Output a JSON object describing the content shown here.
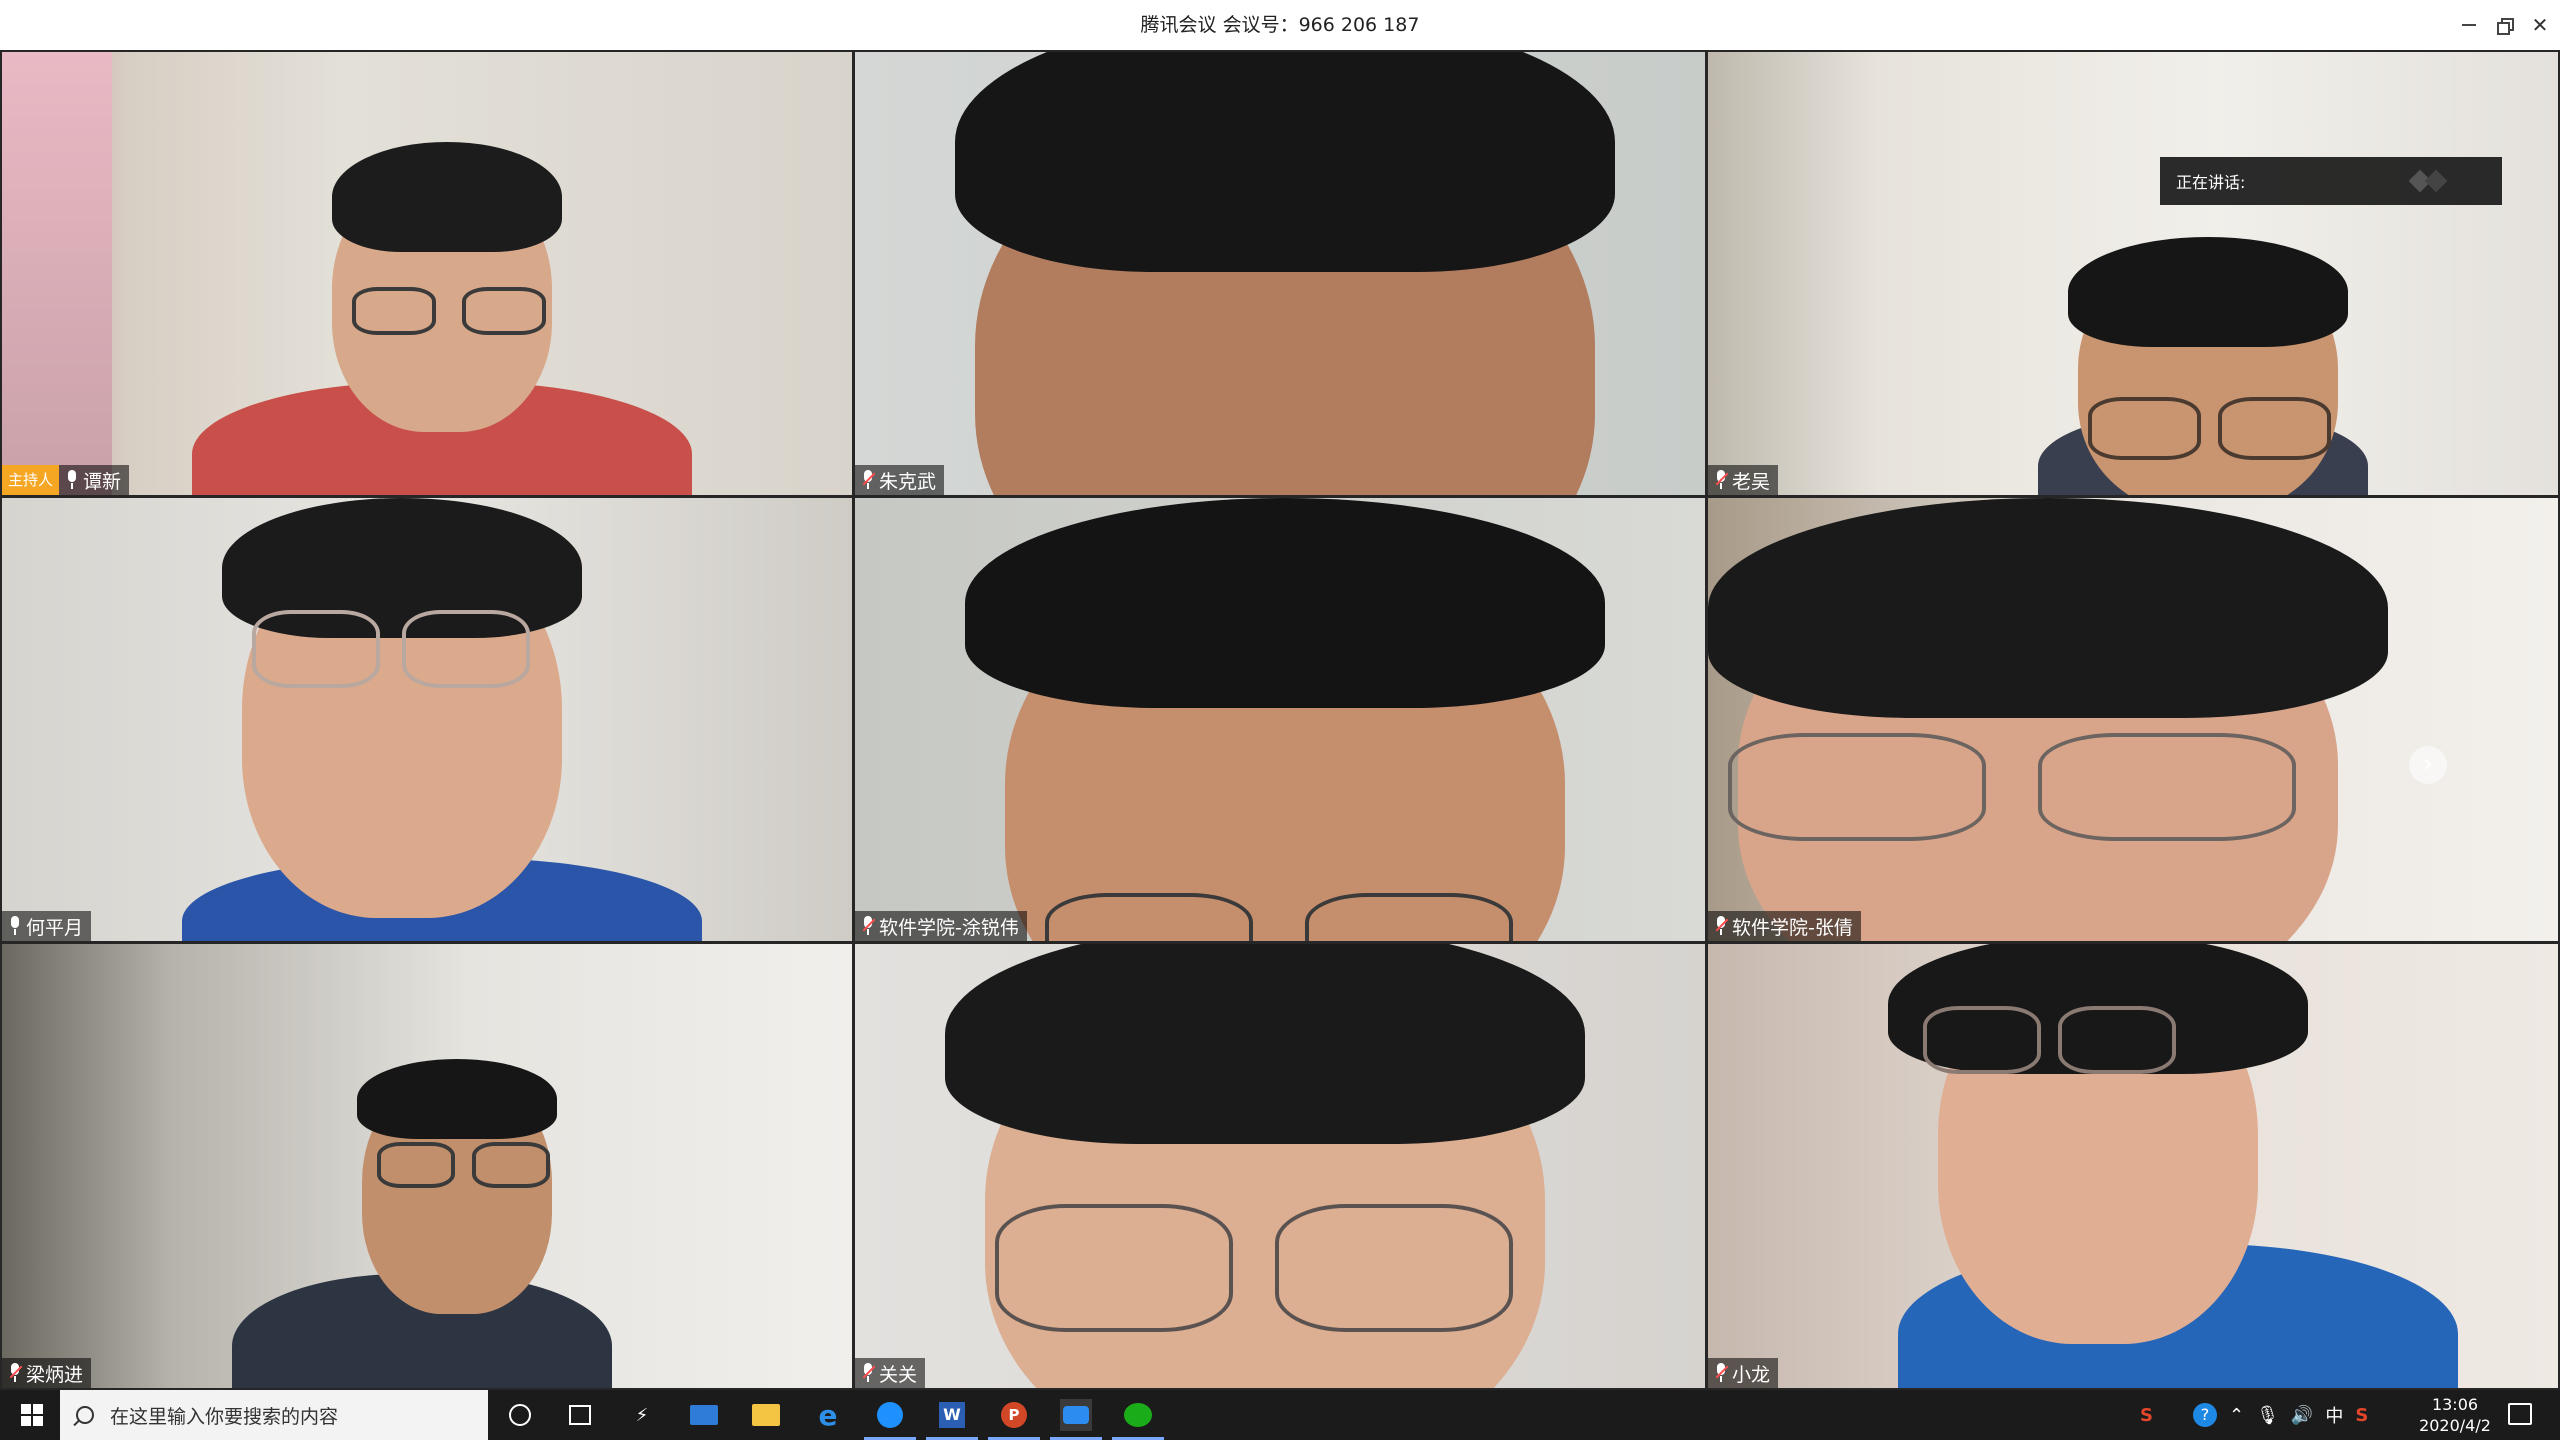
{
  "window": {
    "title": "腾讯会议 会议号：966 206 187"
  },
  "participants": [
    {
      "name": "谭新",
      "host_badge": "主持人",
      "mic": "on"
    },
    {
      "name": "朱克武",
      "mic": "muted"
    },
    {
      "name": "老吴",
      "mic": "muted"
    },
    {
      "name": "何平月",
      "mic": "on"
    },
    {
      "name": "软件学院-涂锐伟",
      "mic": "muted"
    },
    {
      "name": "软件学院-张倩",
      "mic": "muted"
    },
    {
      "name": "梁炳进",
      "mic": "muted"
    },
    {
      "name": "关关",
      "mic": "muted"
    },
    {
      "name": "小龙",
      "mic": "muted"
    }
  ],
  "speaking_indicator": {
    "label": "正在讲话:"
  },
  "taskbar": {
    "search_placeholder": "在这里输入你要搜索的内容",
    "ime_label": "中",
    "time": "13:06",
    "date": "2020/4/2"
  },
  "icons": [
    "windows-start-icon",
    "search-icon",
    "cortana-icon",
    "task-view-icon",
    "mail-icon",
    "file-explorer-icon",
    "edge-icon",
    "qq-browser-icon",
    "word-icon",
    "powerpoint-icon",
    "tencent-meeting-icon",
    "wechat-icon"
  ]
}
